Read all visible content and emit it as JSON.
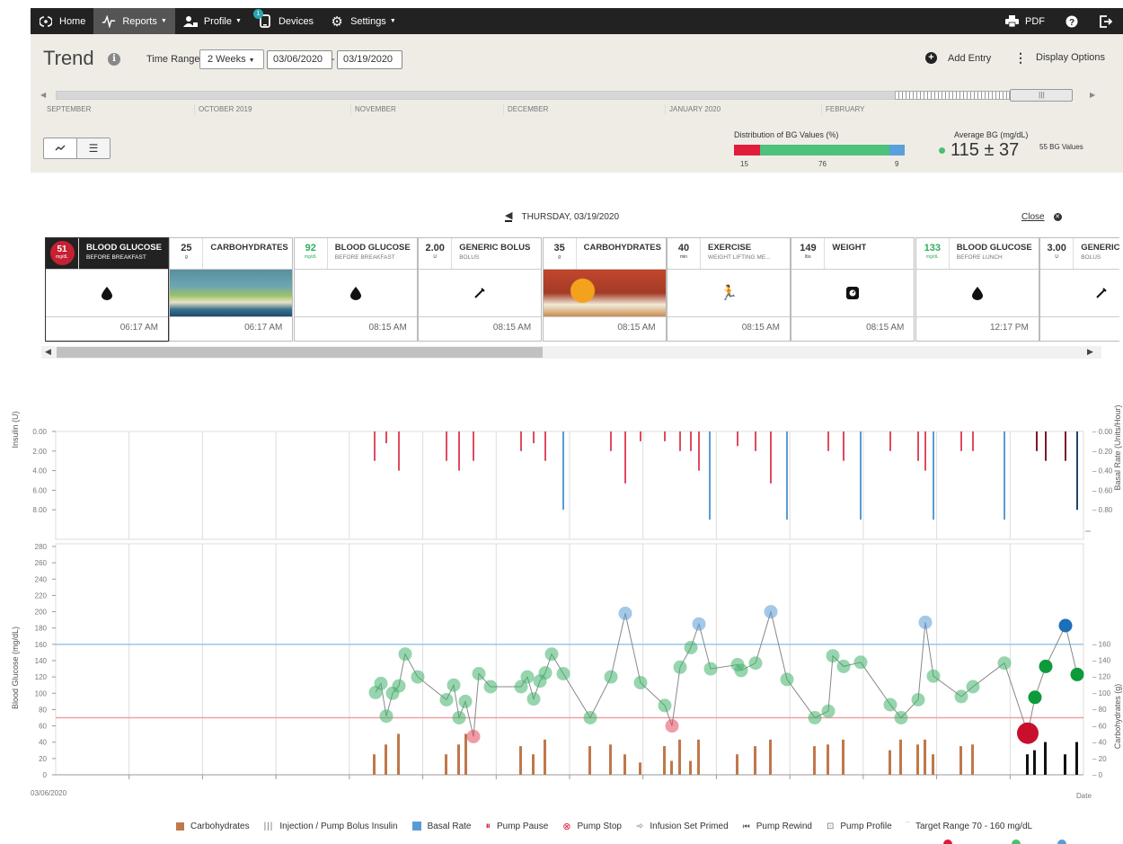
{
  "nav": {
    "home": "Home",
    "reports": "Reports",
    "profile": "Profile",
    "devices": "Devices",
    "devices_badge": "1",
    "settings": "Settings",
    "pdf": "PDF"
  },
  "header": {
    "title": "Trend",
    "time_range_label": "Time Range",
    "time_range_value": "2 Weeks",
    "date_from": "03/06/2020",
    "date_sep": "-",
    "date_to": "03/19/2020",
    "add_entry": "Add Entry",
    "display_options": "Display Options"
  },
  "timeline": {
    "months": [
      "SEPTEMBER",
      "OCTOBER 2019",
      "NOVEMBER",
      "DECEMBER",
      "JANUARY 2020",
      "FEBRUARY"
    ]
  },
  "distribution": {
    "label": "Distribution of BG Values (%)",
    "low": 15,
    "in_range": 76,
    "high": 9,
    "colors": {
      "low": "#e11d3b",
      "in_range": "#4cc27a",
      "high": "#5aa0dc"
    }
  },
  "average": {
    "label": "Average BG (mg/dL)",
    "value": "115 ± 37",
    "count": "55 BG Values"
  },
  "day": {
    "label": "THURSDAY, 03/19/2020",
    "close": "Close"
  },
  "entries": [
    {
      "value": "51",
      "unit": "mg/dL",
      "title": "BLOOD GLUCOSE",
      "subtitle": "BEFORE BREAKFAST",
      "icon": "drop-icon",
      "time": "06:17 AM",
      "style": "bubble"
    },
    {
      "value": "25",
      "unit": "g",
      "title": "CARBOHYDRATES",
      "subtitle": "",
      "icon": "photo-salad",
      "time": "06:17 AM",
      "style": "plain"
    },
    {
      "value": "92",
      "unit": "mg/dL",
      "title": "BLOOD GLUCOSE",
      "subtitle": "BEFORE BREAKFAST",
      "icon": "drop-icon",
      "time": "08:15 AM",
      "style": "green"
    },
    {
      "value": "2.00",
      "unit": "U",
      "title": "GENERIC BOLUS",
      "subtitle": "BOLUS",
      "icon": "syringe-icon",
      "time": "08:15 AM",
      "style": "plain"
    },
    {
      "value": "35",
      "unit": "g",
      "title": "CARBOHYDRATES",
      "subtitle": "",
      "icon": "photo-juice",
      "time": "08:15 AM",
      "style": "plain"
    },
    {
      "value": "40",
      "unit": "min",
      "title": "EXERCISE",
      "subtitle": "WEIGHT LIFTING ME...",
      "icon": "runner-icon",
      "time": "08:15 AM",
      "style": "plain"
    },
    {
      "value": "149",
      "unit": "lbs",
      "title": "WEIGHT",
      "subtitle": "",
      "icon": "scale-icon",
      "time": "08:15 AM",
      "style": "plain"
    },
    {
      "value": "133",
      "unit": "mg/dL",
      "title": "BLOOD GLUCOSE",
      "subtitle": "BEFORE LUNCH",
      "icon": "drop-icon",
      "time": "12:17 PM",
      "style": "green"
    },
    {
      "value": "3.00",
      "unit": "U",
      "title": "GENERIC BOLUS",
      "subtitle": "BOLUS",
      "icon": "syringe-icon",
      "time": "",
      "style": "plain"
    }
  ],
  "chart_labels": {
    "insulin_axis": "Insulin (U)",
    "basal_axis": "Basal Rate (Units/Hour)",
    "bg_axis": "Blood Glucose (mg/dL)",
    "carb_axis": "Carbohydrates (g)",
    "start_date": "03/06/2020",
    "date_axis": "Date"
  },
  "chart_data": {
    "type": "scatter",
    "insulin_ticks": [
      "0.00",
      "2.00",
      "4.00",
      "6.00",
      "8.00"
    ],
    "basal_ticks": [
      "0.00",
      "0.20",
      "0.40",
      "0.60",
      "0.80"
    ],
    "bg_ticks": [
      "0",
      "20",
      "40",
      "60",
      "80",
      "100",
      "120",
      "140",
      "160",
      "180",
      "200",
      "220",
      "240",
      "260",
      "280"
    ],
    "carb_ticks": [
      "0",
      "20",
      "40",
      "60",
      "80",
      "100",
      "120",
      "140",
      "160"
    ],
    "target_range": [
      70,
      160
    ],
    "bg_points": [
      [
        418,
        101
      ],
      [
        424,
        112
      ],
      [
        430,
        72
      ],
      [
        437,
        100
      ],
      [
        444,
        109
      ],
      [
        451,
        148
      ],
      [
        465,
        120
      ],
      [
        497,
        92
      ],
      [
        505,
        110
      ],
      [
        511,
        70
      ],
      [
        518,
        90
      ],
      [
        527,
        47
      ],
      [
        533,
        124
      ],
      [
        546,
        108
      ],
      [
        580,
        108
      ],
      [
        587,
        120
      ],
      [
        594,
        93
      ],
      [
        601,
        115
      ],
      [
        607,
        125
      ],
      [
        614,
        148
      ],
      [
        627,
        124
      ],
      [
        657,
        70
      ],
      [
        680,
        120
      ],
      [
        696,
        198
      ],
      [
        713,
        113
      ],
      [
        740,
        85
      ],
      [
        748,
        60
      ],
      [
        757,
        132
      ],
      [
        769,
        156
      ],
      [
        778,
        185
      ],
      [
        791,
        130
      ],
      [
        821,
        135
      ],
      [
        825,
        128
      ],
      [
        841,
        137
      ],
      [
        858,
        200
      ],
      [
        876,
        117
      ],
      [
        907,
        70
      ],
      [
        922,
        78
      ],
      [
        927,
        146
      ],
      [
        939,
        133
      ],
      [
        958,
        138
      ],
      [
        991,
        86
      ],
      [
        1003,
        70
      ],
      [
        1022,
        92
      ],
      [
        1030,
        187
      ],
      [
        1039,
        121
      ],
      [
        1070,
        96
      ],
      [
        1083,
        108
      ],
      [
        1118,
        137
      ],
      [
        1144,
        51
      ],
      [
        1152,
        95
      ],
      [
        1164,
        133
      ],
      [
        1186,
        183
      ],
      [
        1199,
        123
      ]
    ],
    "carbs": [
      [
        417,
        25
      ],
      [
        430,
        37
      ],
      [
        444,
        50
      ],
      [
        497,
        25
      ],
      [
        511,
        37
      ],
      [
        519,
        50
      ],
      [
        580,
        35
      ],
      [
        594,
        25
      ],
      [
        607,
        43
      ],
      [
        657,
        35
      ],
      [
        680,
        37
      ],
      [
        696,
        25
      ],
      [
        713,
        15
      ],
      [
        740,
        35
      ],
      [
        748,
        17
      ],
      [
        757,
        43
      ],
      [
        769,
        17
      ],
      [
        778,
        43
      ],
      [
        821,
        25
      ],
      [
        841,
        35
      ],
      [
        858,
        43
      ],
      [
        907,
        35
      ],
      [
        922,
        37
      ],
      [
        939,
        43
      ],
      [
        991,
        30
      ],
      [
        1003,
        43
      ],
      [
        1022,
        37
      ],
      [
        1030,
        43
      ],
      [
        1039,
        25
      ],
      [
        1070,
        35
      ],
      [
        1083,
        37
      ],
      [
        1144,
        25
      ],
      [
        1152,
        30
      ],
      [
        1164,
        40
      ],
      [
        1186,
        25
      ],
      [
        1199,
        40
      ]
    ],
    "bolus": [
      [
        417,
        3.0
      ],
      [
        430,
        1.2
      ],
      [
        444,
        4.0
      ],
      [
        497,
        3.0
      ],
      [
        511,
        4.0
      ],
      [
        527,
        3.0
      ],
      [
        580,
        2.0
      ],
      [
        594,
        1.2
      ],
      [
        607,
        3.0
      ],
      [
        680,
        2.0
      ],
      [
        696,
        5.3
      ],
      [
        713,
        1.0
      ],
      [
        740,
        1.0
      ],
      [
        757,
        2.0
      ],
      [
        769,
        2.0
      ],
      [
        778,
        4.0
      ],
      [
        821,
        1.5
      ],
      [
        841,
        2.0
      ],
      [
        858,
        5.3
      ],
      [
        922,
        2.0
      ],
      [
        939,
        3.0
      ],
      [
        991,
        2.0
      ],
      [
        1022,
        3.0
      ],
      [
        1030,
        4.0
      ],
      [
        1070,
        2.0
      ],
      [
        1083,
        2.0
      ],
      [
        1154,
        2.0
      ],
      [
        1164,
        3.0
      ],
      [
        1186,
        3.0
      ]
    ],
    "basal": [
      [
        627,
        0.8
      ],
      [
        790,
        0.9
      ],
      [
        876,
        0.9
      ],
      [
        958,
        0.9
      ],
      [
        1039,
        0.9
      ],
      [
        1118,
        0.9
      ],
      [
        1199,
        0.8
      ]
    ]
  },
  "legend": {
    "carbs": "Carbohydrates",
    "injection": "Injection / Pump Bolus Insulin",
    "basal": "Basal Rate",
    "pump_pause": "Pump Pause",
    "pump_stop": "Pump Stop",
    "infusion": "Infusion Set Primed",
    "rewind": "Pump Rewind",
    "profile": "Pump Profile",
    "target": "Target Range 70 - 160 mg/dL"
  }
}
